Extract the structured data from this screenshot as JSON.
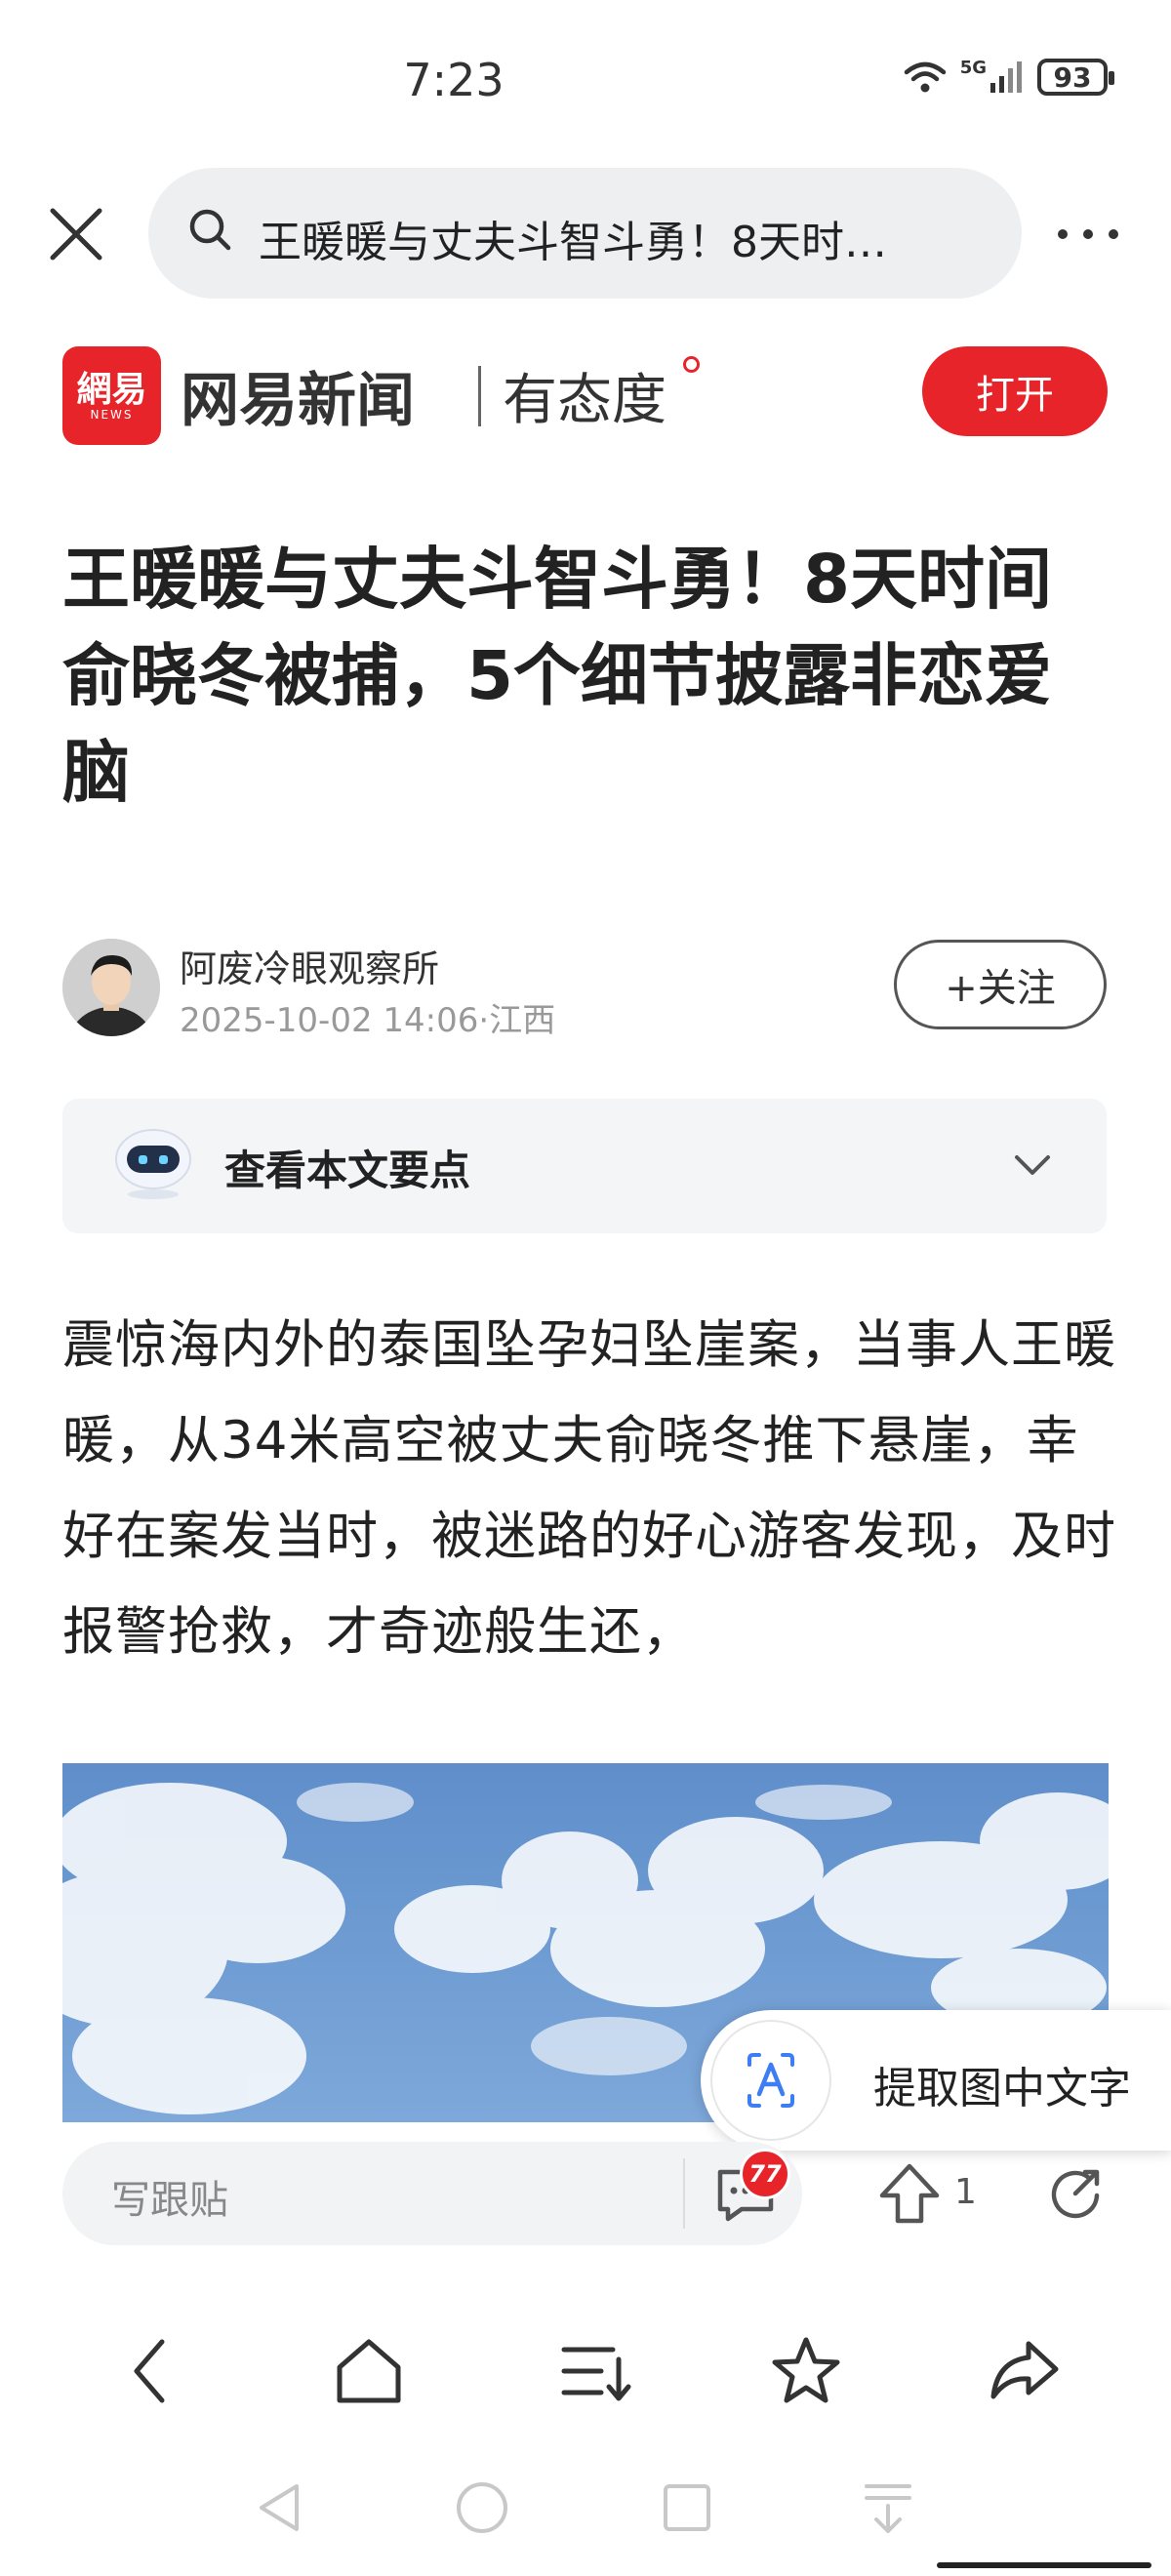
{
  "status_bar": {
    "time": "7:23",
    "network": "5G",
    "battery": "93"
  },
  "search": {
    "query": "王暖暖与丈夫斗智斗勇！8天时…"
  },
  "app_banner": {
    "logo_text": "網易",
    "logo_sub": "NEWS",
    "name": "网易新闻",
    "slogan": "有态度",
    "open_label": "打开"
  },
  "article": {
    "title": "王暖暖与丈夫斗智斗勇！8天时间俞晓冬被捕，5个细节披露非恋爱脑",
    "author": "阿废冷眼观察所",
    "meta": "2025-10-02 14:06·江西",
    "follow_label": "+关注",
    "summary_label": "查看本文要点",
    "body": "震惊海内外的泰国坠孕妇坠崖案，当事人王暖暖，从34米高空被丈夫俞晓冬推下悬崖，幸好在案发当时，被迷路的好心游客发现，及时报警抢救，才奇迹般生还，"
  },
  "ocr_popup": {
    "label": "提取图中文字"
  },
  "comment_bar": {
    "placeholder": "写跟贴",
    "comment_count": "77",
    "like_count": "1"
  },
  "colors": {
    "brand_red": "#e8242b",
    "search_bg": "#eeeff1",
    "summary_bg": "#f4f5f7"
  },
  "icons": [
    "close-icon",
    "search-icon",
    "more-icon",
    "robot-icon",
    "chevron-down-icon",
    "ocr-icon",
    "comment-icon",
    "like-icon",
    "share-icon",
    "back-icon",
    "home-icon",
    "tabs-icon",
    "star-icon",
    "forward-share-icon"
  ]
}
